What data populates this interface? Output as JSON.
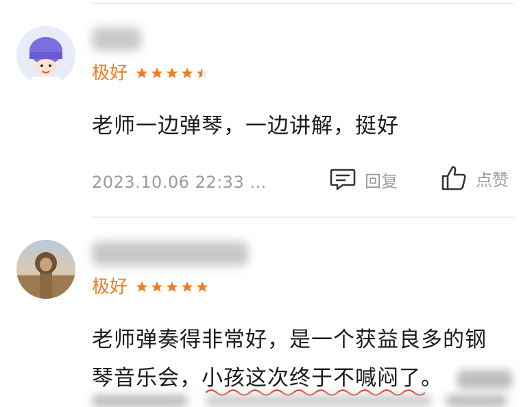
{
  "colors": {
    "accent": "#F07D22",
    "text": "#1a1a1a",
    "muted": "#9a9a9a"
  },
  "actions": {
    "reply_label": "回复",
    "like_label": "点赞",
    "reply_icon": "comment-icon",
    "like_icon": "thumbs-up-icon"
  },
  "reviews": [
    {
      "rating_label": "极好",
      "stars": 4.5,
      "text": "老师一边弹琴，一边讲解，挺好",
      "timestamp": "2023.10.06 22:33 ..."
    },
    {
      "rating_label": "极好",
      "stars": 5,
      "text_line1": "老师弹奏得非常好，是一个获益良多的钢",
      "text_line2_a": "琴音乐会，",
      "text_line2_b": "小孩这次终于不喊闷了",
      "text_line2_c": "。"
    }
  ]
}
